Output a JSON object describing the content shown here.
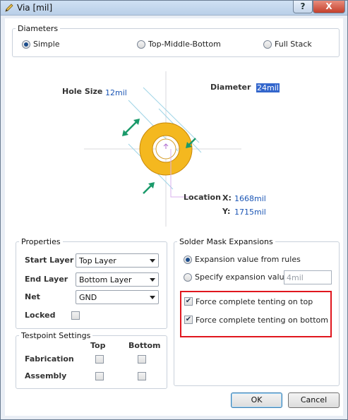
{
  "window": {
    "title": "Via [mil]",
    "help_label": "?",
    "close_label": "X"
  },
  "diameters": {
    "legend": "Diameters",
    "options": [
      "Simple",
      "Top-Middle-Bottom",
      "Full Stack"
    ],
    "selected": "Simple"
  },
  "diagram": {
    "hole_size_label": "Hole Size",
    "hole_size_value": "12mil",
    "diameter_label": "Diameter",
    "diameter_value": "24mil",
    "location_label": "Location",
    "x_label": "X:",
    "x_value": "1668mil",
    "y_label": "Y:",
    "y_value": "1715mil"
  },
  "properties": {
    "legend": "Properties",
    "start_layer_label": "Start Layer",
    "start_layer_value": "Top Layer",
    "end_layer_label": "End Layer",
    "end_layer_value": "Bottom Layer",
    "net_label": "Net",
    "net_value": "GND",
    "locked_label": "Locked",
    "locked": false
  },
  "testpoint": {
    "legend": "Testpoint Settings",
    "col_top": "Top",
    "col_bottom": "Bottom",
    "rows": [
      "Fabrication",
      "Assembly"
    ]
  },
  "solder_mask": {
    "legend": "Solder Mask Expansions",
    "rule_option": "Expansion value from rules",
    "specify_option": "Specify expansion value",
    "expansion_value": "4mil",
    "tent_top": "Force complete tenting on top",
    "tent_bottom": "Force complete tenting on bottom",
    "tent_top_checked": true,
    "tent_bottom_checked": true
  },
  "buttons": {
    "ok": "OK",
    "cancel": "Cancel"
  },
  "colors": {
    "pad": "#f4b81f",
    "pad_outline": "#c8880a",
    "arrow": "#1a9a6a",
    "highlight_box": "#e0161e",
    "crosshair": "#b06fd0"
  }
}
